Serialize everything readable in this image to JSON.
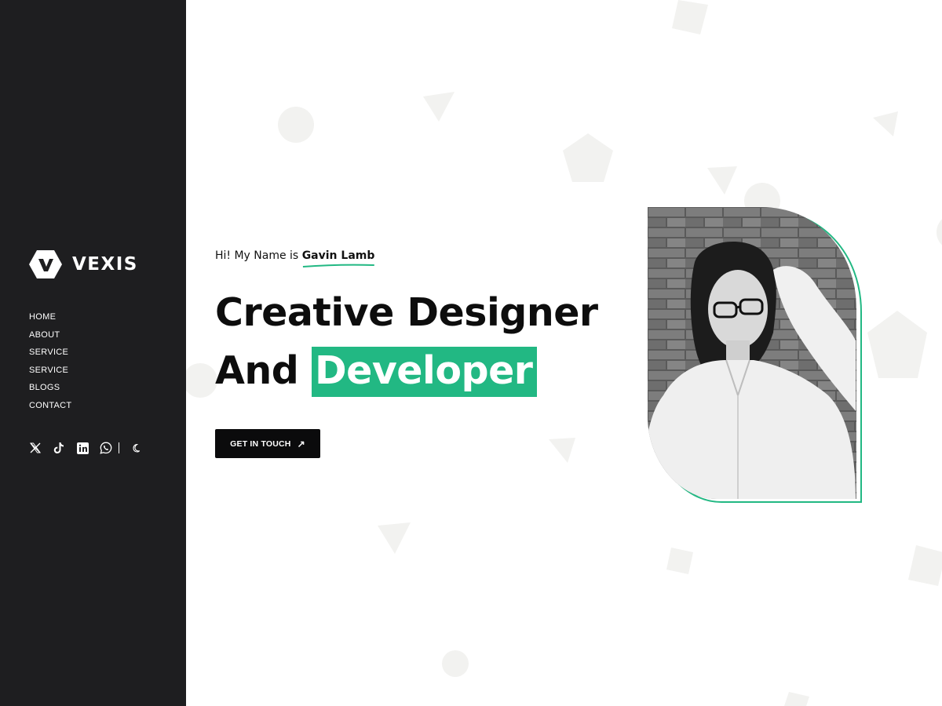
{
  "brand": {
    "name": "VEXIS"
  },
  "nav": {
    "items": [
      "HOME",
      "ABOUT",
      "SERVICE",
      "SERVICE",
      "BLOGS",
      "CONTACT"
    ]
  },
  "socials": {
    "icons": [
      "x-icon",
      "tiktok-icon",
      "linkedin-icon",
      "whatsapp-icon"
    ],
    "theme_toggle": "moon-icon"
  },
  "hero": {
    "intro": "Hi! My Name is",
    "name": "Gavin Lamb",
    "headline_line1": "Creative Designer",
    "headline_line2_plain": "And",
    "headline_line2_highlight": "Developer",
    "cta_label": "GET IN TOUCH"
  },
  "colors": {
    "sidebar_bg": "#1e1e20",
    "accent": "#22b883",
    "text": "#0d0d0d",
    "button_bg": "#0b0b0c",
    "shape": "#f2f2f0"
  }
}
